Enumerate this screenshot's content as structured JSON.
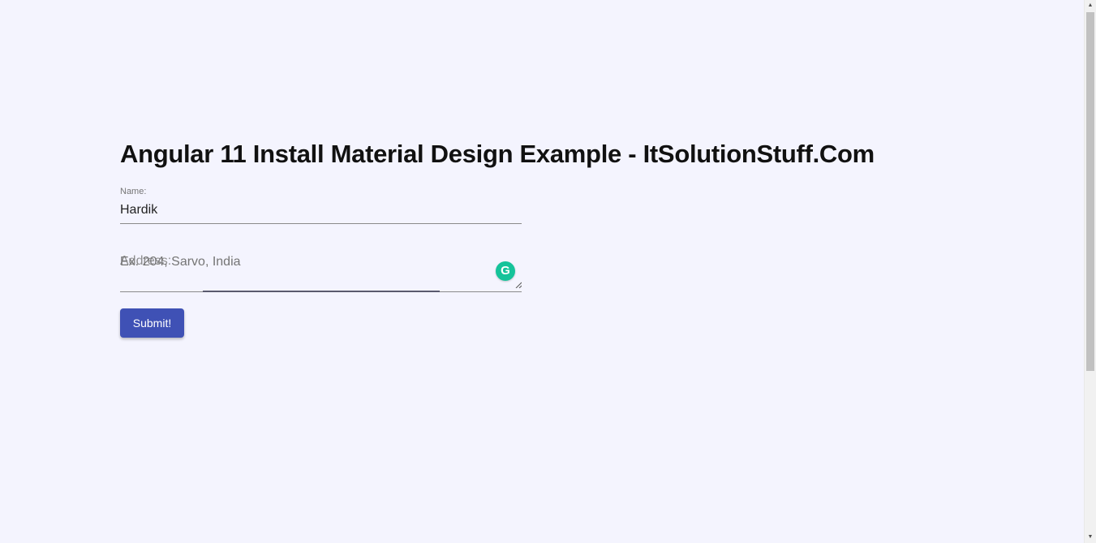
{
  "page": {
    "title": "Angular 11 Install Material Design Example - ItSolutionStuff.Com"
  },
  "form": {
    "name_label": "Name:",
    "name_value": "Hardik",
    "address_label": "Address:",
    "address_placeholder": "Ex. 204, Sarvo, India",
    "submit_label": "Submit!"
  },
  "grammarly": {
    "icon": "grammarly-icon",
    "glyph": "G"
  },
  "scrollbar": {
    "up_glyph": "▲",
    "down_glyph": "▼"
  },
  "colors": {
    "background": "#f4f4fe",
    "primary": "#3f51b5",
    "grammarly": "#15c39a"
  }
}
